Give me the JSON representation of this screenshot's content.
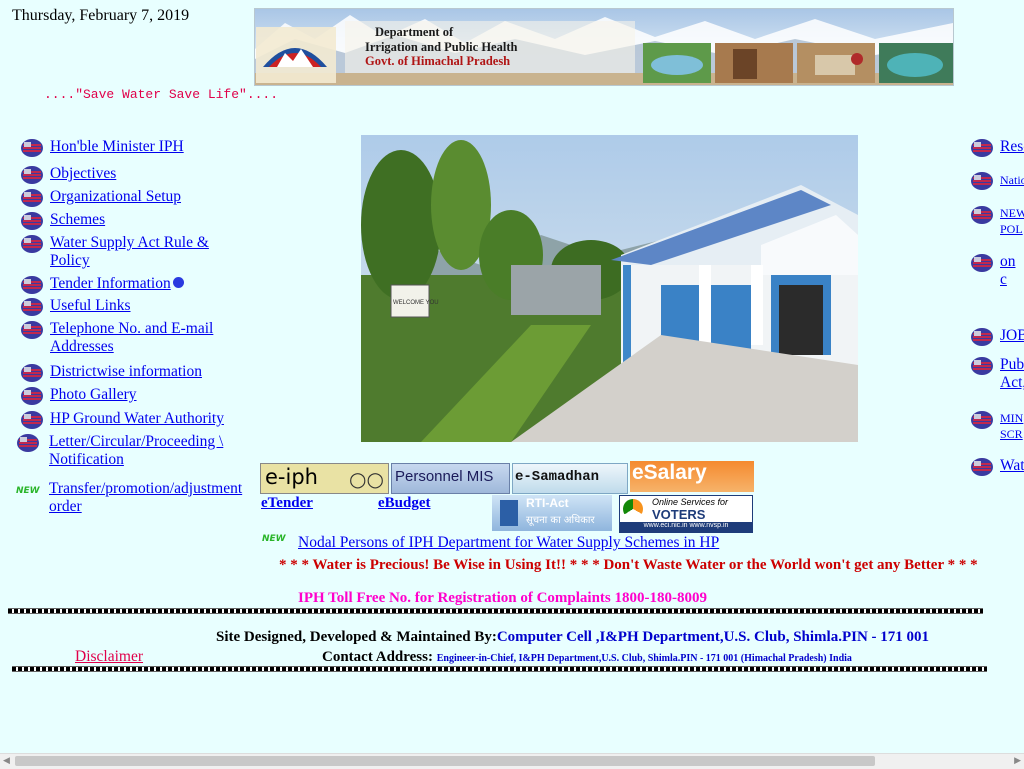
{
  "date": "Thursday, February 7, 2019",
  "banner": {
    "line1": "Department of",
    "line2": "Irrigation and Public Health",
    "line3": "Govt. of Himachal Pradesh"
  },
  "slogan": "....\"Save Water Save Life\"....",
  "left_nav": [
    "Hon'ble Minister IPH",
    "Objectives",
    "Organizational Setup",
    "Schemes",
    "Water Supply Act Rule & Policy",
    "Tender Information",
    "Useful Links",
    "Telephone No. and E-mail Addresses",
    "Districtwise information",
    "Photo Gallery",
    "HP Ground Water Authority",
    "Letter/Circular/Proceeding \\ Notification",
    "Transfer/promotion/adjustment order"
  ],
  "right_nav": [
    "Rese",
    "Natio",
    "NEW POL",
    "on c",
    "JOB",
    "Publ Act,",
    "MIN SCR",
    "Wat"
  ],
  "new_badge": "NEW",
  "buttons": {
    "eiph": "e-iph",
    "personnel": "Personnel MIS",
    "samadhan": "e-Samadhan",
    "esalary": "eSalary",
    "etender": "eTender",
    "ebudget": "eBudget",
    "rti_top": "RTI-Act",
    "rti_bottom": "सूचना का अधिकार",
    "voters_top": "Online Services for",
    "voters_main": "VOTERS",
    "voters_url": "www.eci.nic.in  www.nvsp.in"
  },
  "nodal_link": "Nodal Persons of IPH Department for Water Supply Schemes in HP",
  "ticker": "* * * Water is Precious! Be Wise in Using It!! * * * Don't Waste Water or the World won't get any Better * * *",
  "toll_free": "IPH Toll Free No. for Registration of Complaints 1800-180-8009",
  "disclaimer": "Disclaimer",
  "designed_label": "Site Designed, Developed & Maintained By:",
  "designed_by": "Computer Cell ,I&PH Department,U.S. Club, Shimla.PIN - 171 001",
  "contact_label": "Contact Address:",
  "contact_address": "Engineer-in-Chief, I&PH Department,U.S. Club, Shimla.PIN - 171 001 (Himachal Pradesh) India",
  "photo_sign": "WELCOME YOU",
  "colors": {
    "background": "#e8ffff",
    "link": "#0000ee",
    "slogan": "#e0004a",
    "ticker": "#cc0000",
    "toll": "#ff00cc"
  }
}
